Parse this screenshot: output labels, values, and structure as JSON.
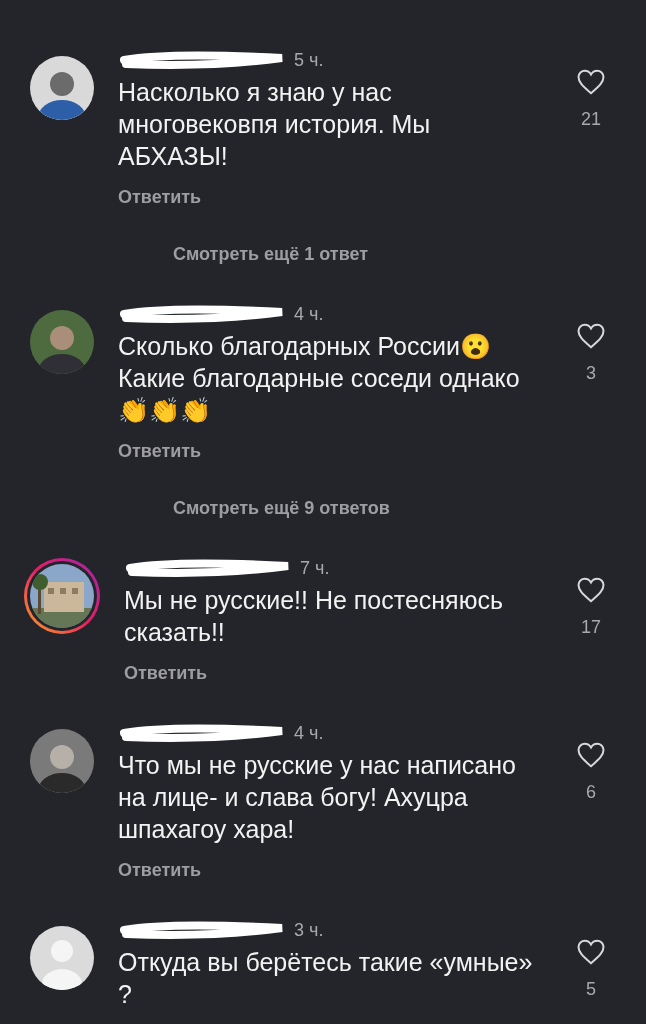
{
  "comments": [
    {
      "avatar": {
        "kind": "picture",
        "story_ring": false
      },
      "time": "5 ч.",
      "text": "Насколько я знаю у нас многовековпя история. Мы АБХАЗЫ!",
      "likes": "21",
      "reply": "Ответить",
      "more_replies": "Смотреть ещё 1 ответ"
    },
    {
      "avatar": {
        "kind": "picture",
        "story_ring": false
      },
      "time": "4 ч.",
      "text": "Сколько благодарных России😮 Какие благодарные соседи однако 👏👏👏",
      "likes": "3",
      "reply": "Ответить",
      "more_replies": "Смотреть ещё 9 ответов"
    },
    {
      "avatar": {
        "kind": "picture",
        "story_ring": true
      },
      "time": "7 ч.",
      "text": "Мы не русские!! Не постесняюсь сказать!!",
      "likes": "17",
      "reply": "Ответить"
    },
    {
      "avatar": {
        "kind": "picture",
        "story_ring": false
      },
      "time": "4 ч.",
      "text": "Что мы не русские у нас написано на лице- и слава богу! Ахуцра шпахагоу хара!",
      "likes": "6",
      "reply": "Ответить"
    },
    {
      "avatar": {
        "kind": "default",
        "story_ring": false
      },
      "time": "3 ч.",
      "text": "Откуда вы берётесь такие «умные» ?",
      "likes": "5"
    }
  ]
}
